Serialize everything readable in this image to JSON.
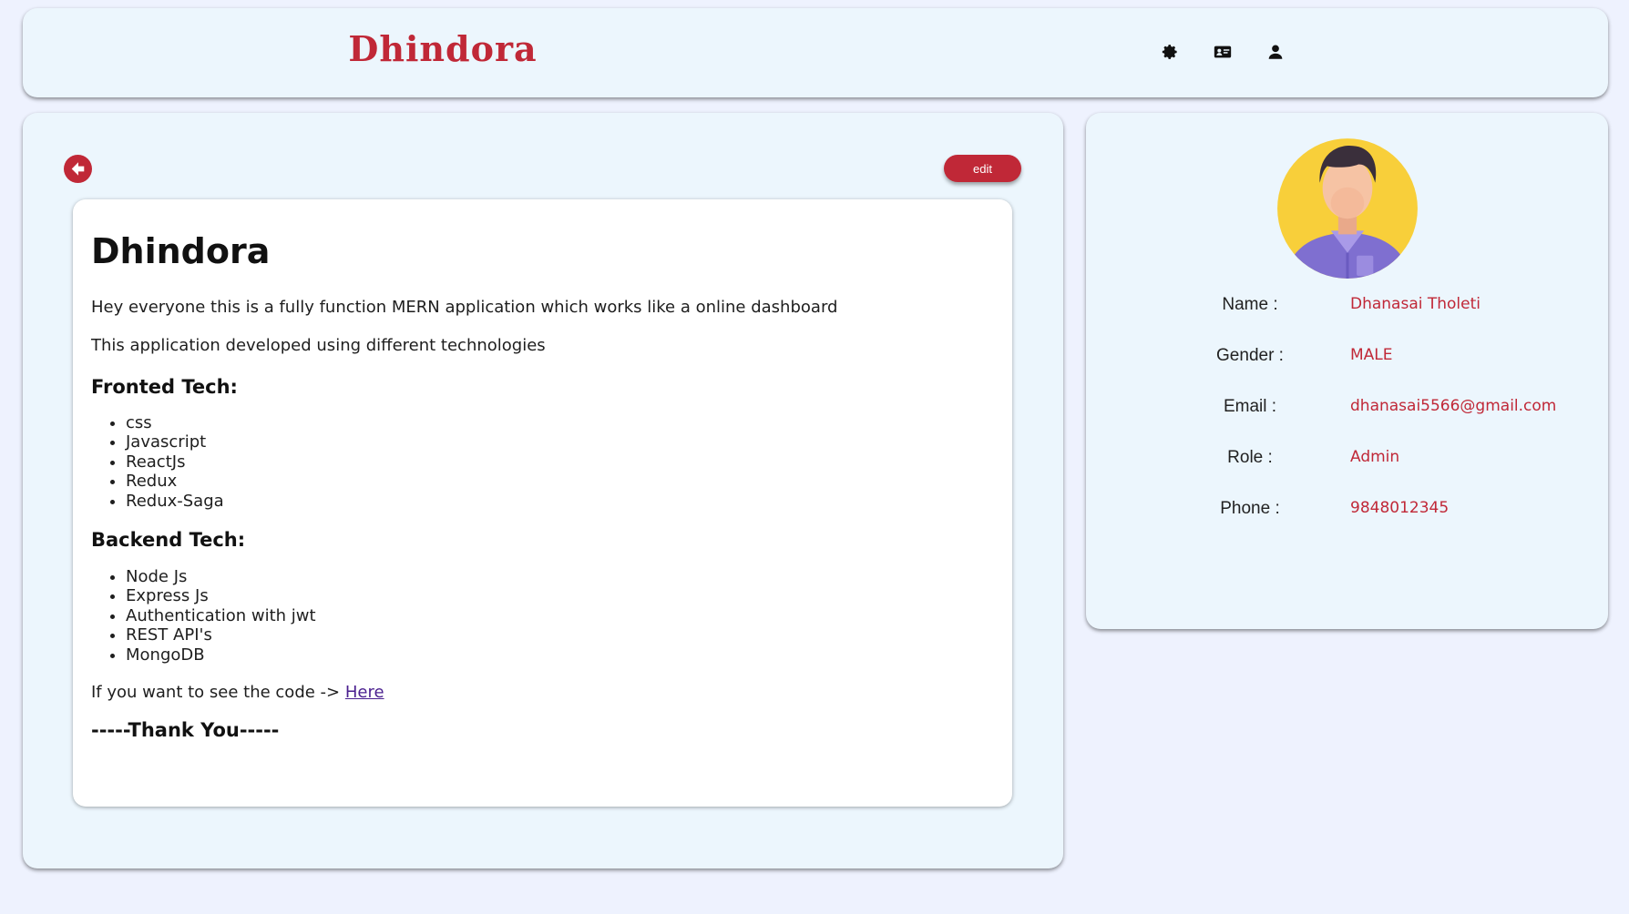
{
  "header": {
    "brand": "Dhindora",
    "icons": [
      "gear-icon",
      "id-card-icon",
      "user-icon"
    ]
  },
  "main": {
    "edit_label": "edit",
    "article": {
      "title": "Dhindora",
      "intro": "Hey everyone this is a fully function MERN application which works like a online dashboard",
      "intro2": "This application developed using different technologies",
      "frontend_heading": "Fronted Tech:",
      "frontend_items": [
        "css",
        "Javascript",
        "ReactJs",
        "Redux",
        "Redux-Saga"
      ],
      "backend_heading": "Backend Tech:",
      "backend_items": [
        "Node Js",
        "Express Js",
        "Authentication with jwt",
        "REST API's",
        "MongoDB"
      ],
      "code_text": "If you want to see the code ->",
      "code_link": "Here",
      "thanks": "-----Thank You-----"
    }
  },
  "profile": {
    "fields": [
      {
        "label": "Name :",
        "value": "Dhanasai Tholeti"
      },
      {
        "label": "Gender :",
        "value": "MALE"
      },
      {
        "label": "Email :",
        "value": "dhanasai5566@gmail.com"
      },
      {
        "label": "Role :",
        "value": "Admin"
      },
      {
        "label": "Phone :",
        "value": "9848012345"
      }
    ]
  },
  "colors": {
    "accent": "#c02837",
    "panel": "#ecf6fd",
    "background": "#eef2fe"
  }
}
